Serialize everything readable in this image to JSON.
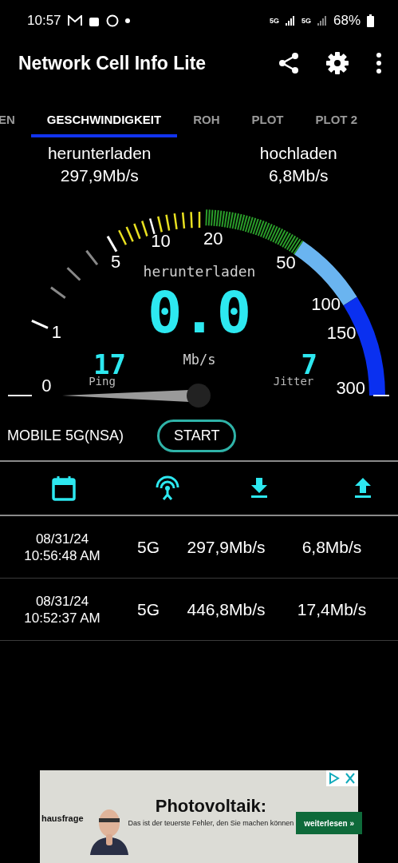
{
  "status_bar": {
    "time": "10:57",
    "network_1": "5G",
    "network_2": "5G",
    "battery": "68%"
  },
  "app_bar": {
    "title": "Network Cell Info Lite"
  },
  "tabs": [
    {
      "label": "EN",
      "selected": false
    },
    {
      "label": "GESCHWINDIGKEIT",
      "selected": true
    },
    {
      "label": "ROH",
      "selected": false
    },
    {
      "label": "PLOT",
      "selected": false
    },
    {
      "label": "PLOT 2",
      "selected": false
    }
  ],
  "summary": [
    {
      "label": "herunterladen",
      "value": "297,9Mb/s"
    },
    {
      "label": "hochladen",
      "value": "6,8Mb/s"
    }
  ],
  "gauge": {
    "scale": [
      "0",
      "1",
      "5",
      "10",
      "20",
      "50",
      "100",
      "150",
      "300"
    ],
    "mode": "herunterladen",
    "reading": "0.0",
    "unit": "Mb/s",
    "ping": {
      "label": "Ping",
      "value": "17"
    },
    "jitter": {
      "label": "Jitter",
      "value": "7"
    }
  },
  "connection": {
    "type": "MOBILE 5G(NSA)",
    "button": "START"
  },
  "history": {
    "rows": [
      {
        "date": "08/31/24",
        "time": "10:56:48 AM",
        "network": "5G",
        "download": "297,9Mb/s",
        "upload": "6,8Mb/s"
      },
      {
        "date": "08/31/24",
        "time": "10:52:37 AM",
        "network": "5G",
        "download": "446,8Mb/s",
        "upload": "17,4Mb/s"
      }
    ]
  },
  "ad": {
    "brand": "hausfrage",
    "headline": "Photovoltaik:",
    "text": "Das ist der teuerste Fehler, den Sie machen können",
    "button": "weiterlesen »"
  }
}
